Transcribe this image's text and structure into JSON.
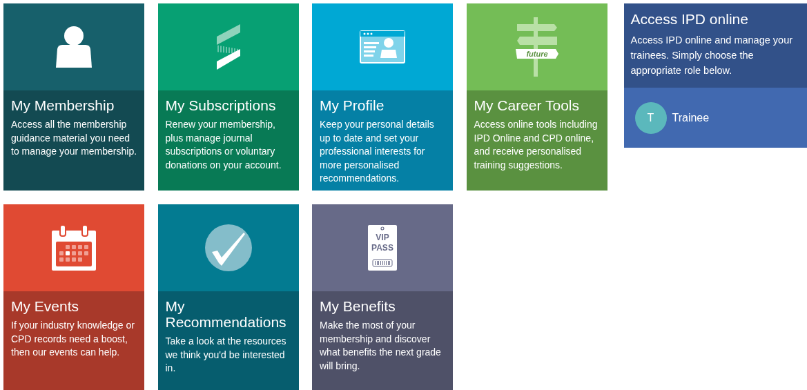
{
  "tiles": [
    {
      "kind": "membership",
      "title": "My Membership",
      "body": "Access all the membership guidance material you need to manage your membership."
    },
    {
      "kind": "subscriptions",
      "title": "My Subscriptions",
      "body": "Renew your membership, plus manage journal subscriptions or voluntary donations on your account."
    },
    {
      "kind": "profile",
      "title": "My Profile",
      "body": "Keep your personal details up to date and set your professional interests for more personalised recommendations."
    },
    {
      "kind": "career",
      "title": "My Career Tools",
      "body": "Access online tools including IPD Online and CPD online, and receive personalised training suggestions.",
      "icon_label": "future"
    },
    {
      "kind": "events",
      "title": "My Events",
      "body": "If your industry knowledge or CPD records need a boost, then our events can help."
    },
    {
      "kind": "recommendations",
      "title": "My Recommendations",
      "body": "Take a look at the resources we think you'd be interested in."
    },
    {
      "kind": "benefits",
      "title": "My Benefits",
      "body": "Make the most of your membership and discover what benefits the next grade will bring.",
      "icon_label": [
        "VIP",
        "PASS"
      ]
    }
  ],
  "ipd": {
    "title": "Access IPD online",
    "body": "Access IPD online and manage your trainees. Simply choose the appropriate role below.",
    "roles": [
      {
        "initial": "T",
        "label": "Trainee"
      }
    ]
  }
}
